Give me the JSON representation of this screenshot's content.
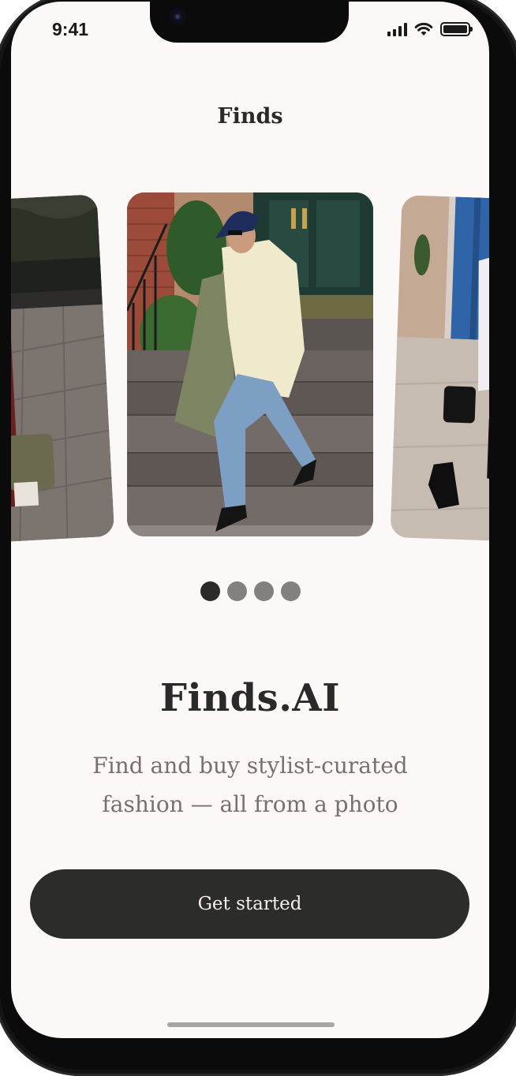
{
  "status_bar": {
    "time": "9:41",
    "icons": [
      "cellular-signal-icon",
      "wifi-icon",
      "battery-icon"
    ]
  },
  "header": {
    "title": "Finds"
  },
  "carousel": {
    "total_slides": 4,
    "active_index": 0,
    "photos": [
      "street-style-photo-left",
      "street-style-photo-center",
      "street-style-photo-right"
    ]
  },
  "hero": {
    "title": "Finds.AI",
    "tagline": "Find and buy stylist-curated fashion — all from a photo"
  },
  "cta": {
    "label": "Get started"
  },
  "colors": {
    "background": "#fcf8f7",
    "primary_dark": "#2c2c2b",
    "tagline_gray": "#77706d",
    "dot_inactive": "#84807e"
  }
}
